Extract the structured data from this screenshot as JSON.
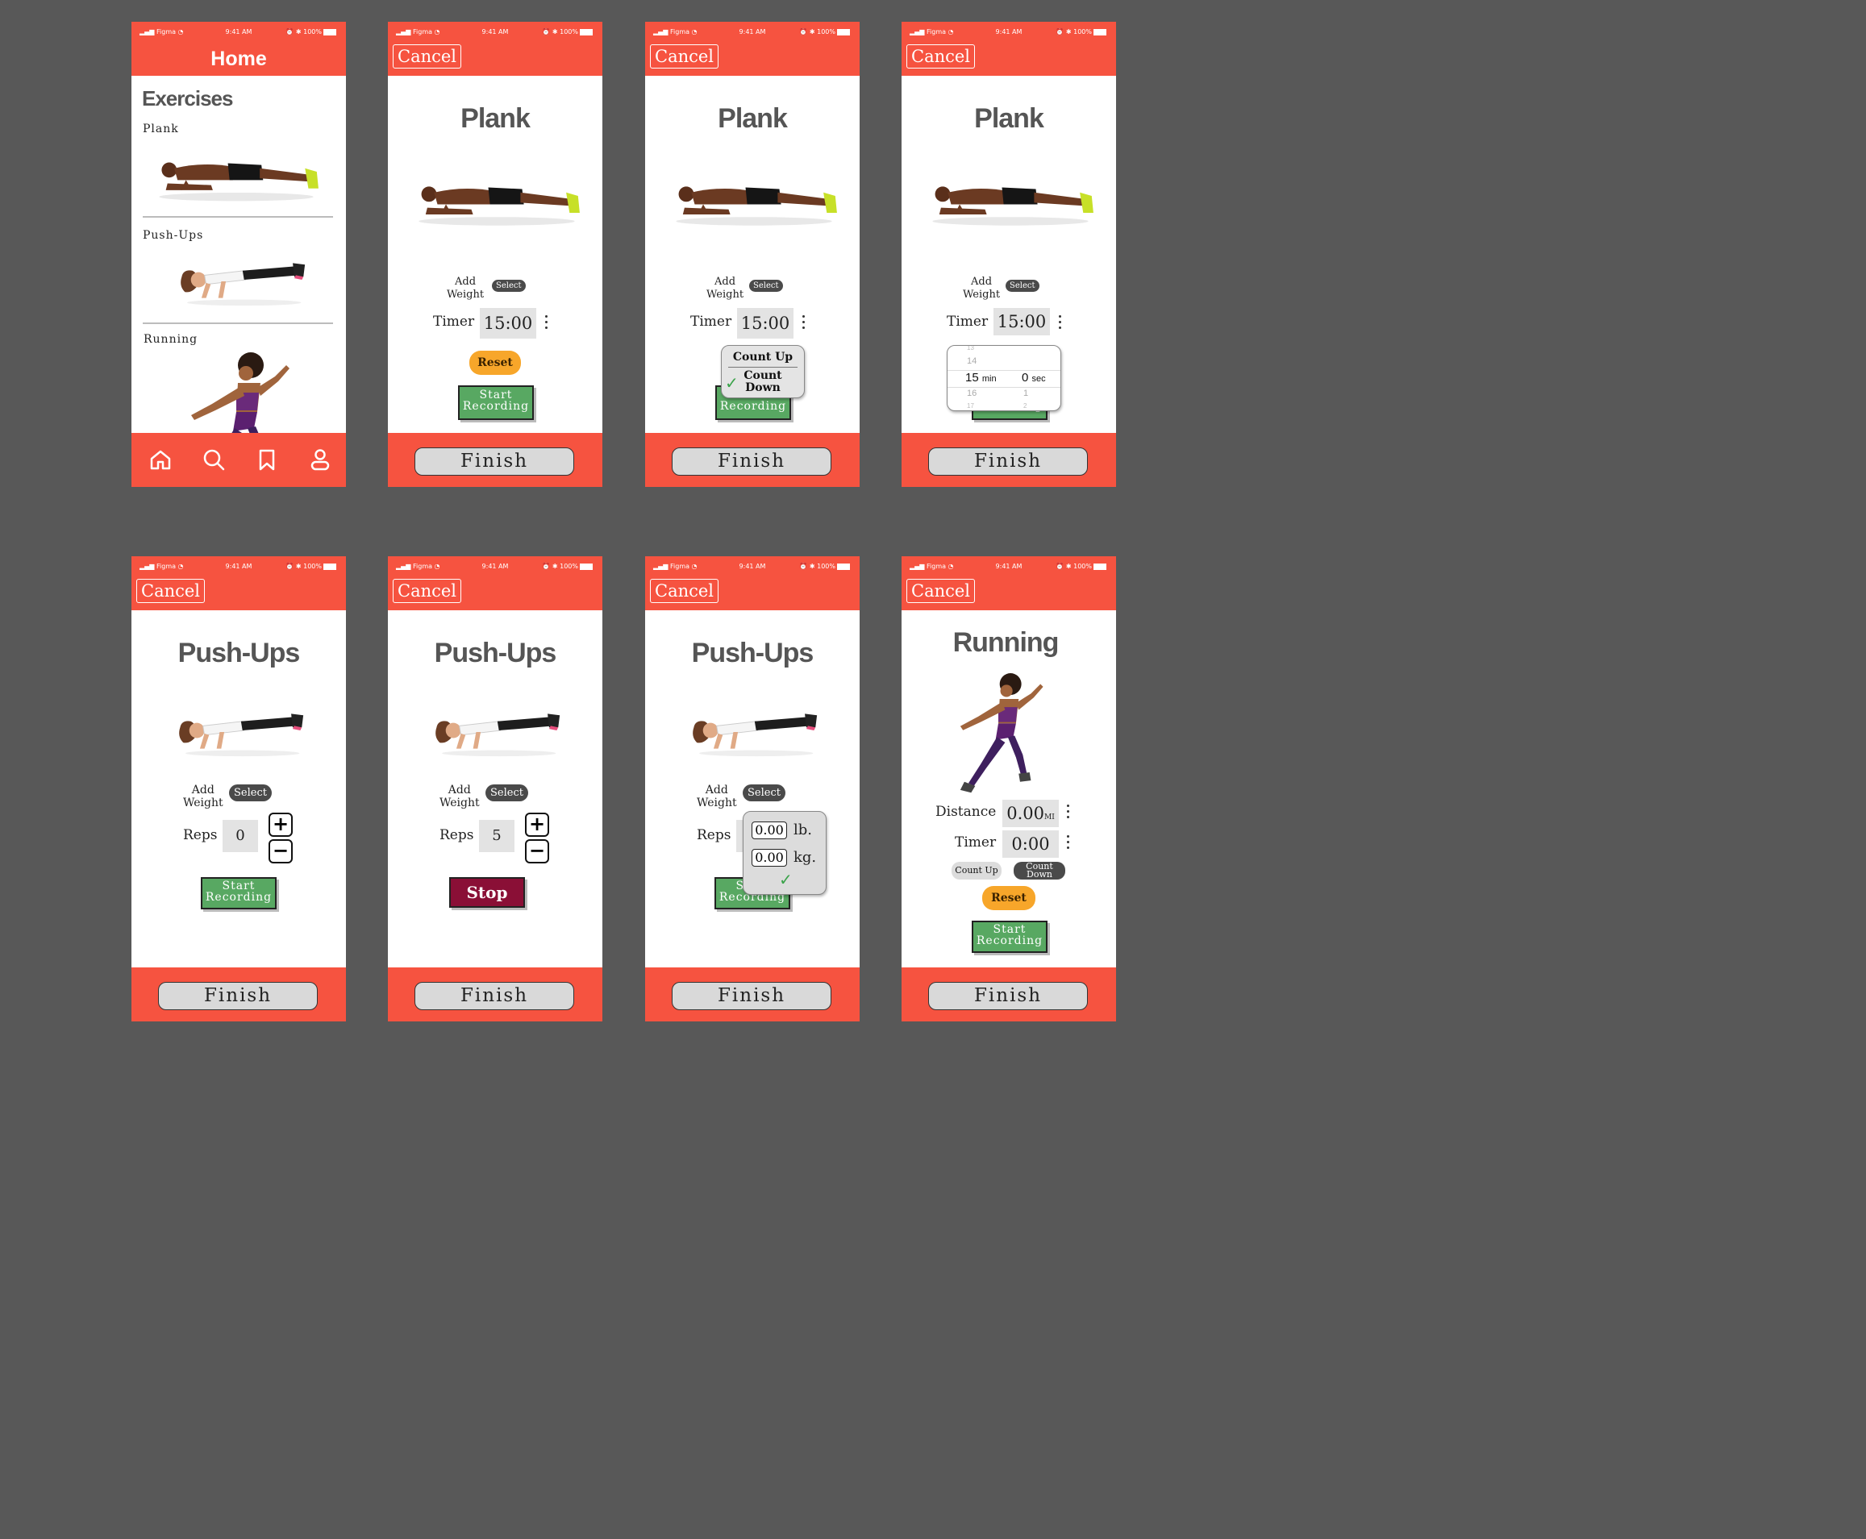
{
  "status": {
    "carrier": "Figma",
    "time": "9:41 AM",
    "battery": "100%"
  },
  "colors": {
    "accent": "#f65340",
    "record": "#58a862",
    "stop": "#8a0f36",
    "reset": "#f7a62a"
  },
  "home": {
    "title": "Home",
    "section": "Exercises",
    "exercises": [
      "Plank",
      "Push-Ups",
      "Running"
    ],
    "nav": [
      "home-icon",
      "search-icon",
      "bookmark-icon",
      "profile-icon"
    ]
  },
  "common": {
    "cancel": "Cancel",
    "finish": "Finish",
    "add_weight_1": "Add",
    "add_weight_2": "Weight",
    "select": "Select",
    "timer": "Timer",
    "reset": "Reset",
    "rec_1": "Start",
    "rec_2": "Recording",
    "reps": "Reps",
    "stop": "Stop"
  },
  "plank": {
    "title": "Plank",
    "timer_value": "15:00"
  },
  "timer_menu": {
    "count_up": "Count Up",
    "count_down_1": "Count",
    "count_down_2": "Down",
    "check": "✓"
  },
  "picker": {
    "min_values": [
      "13",
      "14",
      "15",
      "16",
      "17"
    ],
    "min_unit": "min",
    "sec_values": [
      "",
      "",
      "0",
      "1",
      "2"
    ],
    "sec_unit": "sec"
  },
  "pushups": {
    "title": "Push-Ups",
    "reps_a": "0",
    "reps_b": "5",
    "plus": "+",
    "minus": "−"
  },
  "weight_popup": {
    "lb_value": "0.00",
    "lb_unit": "lb.",
    "kg_value": "0.00",
    "kg_unit": "kg.",
    "check": "✓"
  },
  "running": {
    "title": "Running",
    "distance_label": "Distance",
    "distance_value": "0.00",
    "distance_unit": "MI",
    "timer_value": "0:00",
    "count_up": "Count Up",
    "count_down_1": "Count",
    "count_down_2": "Down"
  }
}
